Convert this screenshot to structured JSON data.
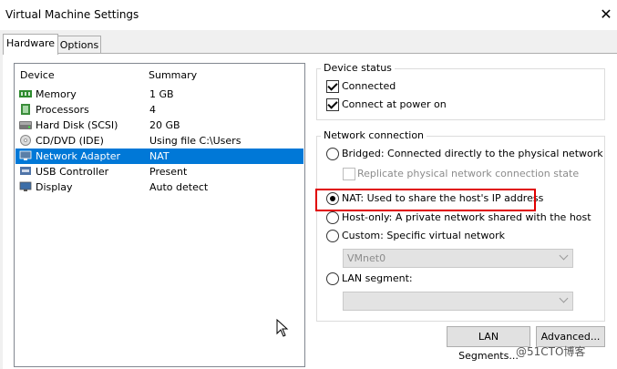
{
  "window": {
    "title": "Virtual Machine Settings",
    "close_glyph": "✕"
  },
  "tabs": [
    {
      "label": "Hardware",
      "active": true
    },
    {
      "label": "Options",
      "active": false
    }
  ],
  "device_list": {
    "headers": {
      "device": "Device",
      "summary": "Summary"
    },
    "rows": [
      {
        "device": "Memory",
        "summary": "1 GB",
        "icon": "memory-icon"
      },
      {
        "device": "Processors",
        "summary": "4",
        "icon": "processor-icon"
      },
      {
        "device": "Hard Disk (SCSI)",
        "summary": "20 GB",
        "icon": "hard-disk-icon"
      },
      {
        "device": "CD/DVD (IDE)",
        "summary": "Using file C:\\Users",
        "icon": "cd-dvd-icon"
      },
      {
        "device": "Network Adapter",
        "summary": "NAT",
        "icon": "network-adapter-icon",
        "selected": true
      },
      {
        "device": "USB Controller",
        "summary": "Present",
        "icon": "usb-icon"
      },
      {
        "device": "Display",
        "summary": "Auto detect",
        "icon": "display-icon"
      }
    ]
  },
  "device_status": {
    "title": "Device status",
    "connected": {
      "label": "Connected",
      "checked": true
    },
    "connect_at_power_on": {
      "label": "Connect at power on",
      "checked": true
    }
  },
  "network_connection": {
    "title": "Network connection",
    "bridged": {
      "label": "Bridged: Connected directly to the physical network",
      "checked": false
    },
    "replicate": {
      "label": "Replicate physical network connection state",
      "checked": false,
      "disabled": true
    },
    "nat": {
      "label": "NAT: Used to share the host's IP address",
      "checked": true
    },
    "host_only": {
      "label": "Host-only: A private network shared with the host",
      "checked": false
    },
    "custom": {
      "label": "Custom: Specific virtual network",
      "checked": false
    },
    "custom_select": {
      "value": "VMnet0"
    },
    "lan_segment": {
      "label": "LAN segment:",
      "checked": false
    },
    "lan_select": {
      "value": ""
    }
  },
  "buttons": {
    "lan_segments": "LAN Segments...",
    "advanced": "Advanced..."
  },
  "watermark": "@51CTO博客",
  "colors": {
    "selection": "#0078d7",
    "highlight": "#e00000"
  }
}
